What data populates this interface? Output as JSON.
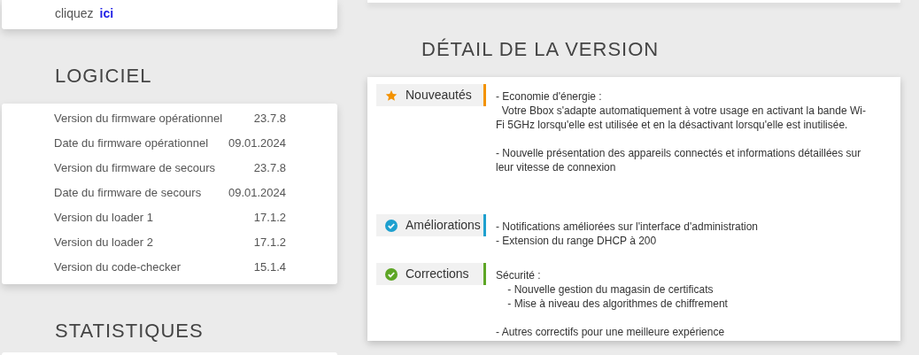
{
  "top_card": {
    "text": "cliquez",
    "link": "ici"
  },
  "software": {
    "title": "LOGICIEL",
    "rows": [
      {
        "label": "Version du firmware opérationnel",
        "value": "23.7.8"
      },
      {
        "label": "Date du firmware opérationnel",
        "value": "09.01.2024"
      },
      {
        "label": "Version du firmware de secours",
        "value": "23.7.8"
      },
      {
        "label": "Date du firmware de secours",
        "value": "09.01.2024"
      },
      {
        "label": "Version du loader 1",
        "value": "17.1.2"
      },
      {
        "label": "Version du loader 2",
        "value": "17.1.2"
      },
      {
        "label": "Version du code-checker",
        "value": "15.1.4"
      }
    ]
  },
  "statistics": {
    "title": "STATISTIQUES"
  },
  "release_details": {
    "title": "DÉTAIL DE LA VERSION",
    "sections": [
      {
        "label": "Nouveautés",
        "kind": "star",
        "color": "#f39200",
        "blocks": [
          [
            "- Economie d'énergie :",
            "  Votre Bbox s'adapte automatiquement à votre usage en activant la bande Wi-Fi 5GHz lorsqu'elle est utilisée et en la désactivant lorsqu'elle est inutilisée."
          ],
          [
            "- Nouvelle présentation des appareils connectés et informations détaillées sur leur vitesse de connexion"
          ]
        ]
      },
      {
        "label": "Améliorations",
        "kind": "check",
        "color": "#1ea0cf",
        "blocks": [
          [
            "- Notifications améliorées sur l'interface d'administration",
            "- Extension du range DHCP à 200"
          ]
        ]
      },
      {
        "label": "Corrections",
        "kind": "check",
        "color": "#5ea626",
        "blocks": [
          [
            "Sécurité :",
            "    - Nouvelle gestion du magasin de certificats",
            "    - Mise à niveau des algorithmes de chiffrement"
          ],
          [
            "- Autres correctifs pour une meilleure expérience"
          ]
        ]
      }
    ]
  }
}
